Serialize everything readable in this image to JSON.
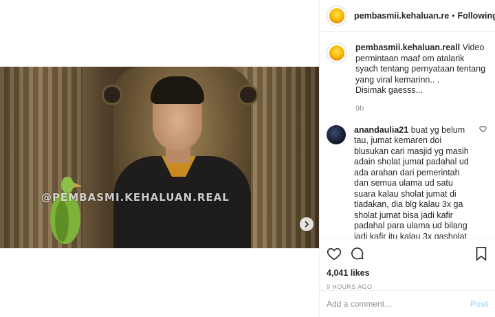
{
  "header": {
    "username": "pembasmii.kehaluan.re",
    "separator": "•",
    "follow_label": "Following"
  },
  "media": {
    "watermark": "@PEMBASMI.KEHALUAN.REAL",
    "next_icon": "chevron-right-icon"
  },
  "caption": {
    "username": "pembasmii.kehaluan.reall",
    "text": "Video permintaan maaf om atalarik syach tentang pernyataan tentang yang viral kemarinn.. .",
    "text2": "Disimak gaesss...",
    "time": "9h"
  },
  "comment": {
    "username": "anandaulia21",
    "text": "buat yg belum tau, jumat kemaren doi blusukan cari masjid yg masih adain sholat jumat padahal ud ada arahan dari pemerintah dan semua ulama ud satu suara kalau sholat jumat di tiadakan, dia blg kalau 3x ga sholat jumat bisa jadi kafir padahal para ulama ud bilang jadi kafir itu kalau 3x gasholat dengan alasan malas dan disengaja, pas dia dapet masjid yg masih adain"
  },
  "actions": {
    "likes": "4,041 likes",
    "posted": "9 HOURS AGO"
  },
  "add_comment": {
    "placeholder": "Add a comment…",
    "post_label": "Post"
  }
}
